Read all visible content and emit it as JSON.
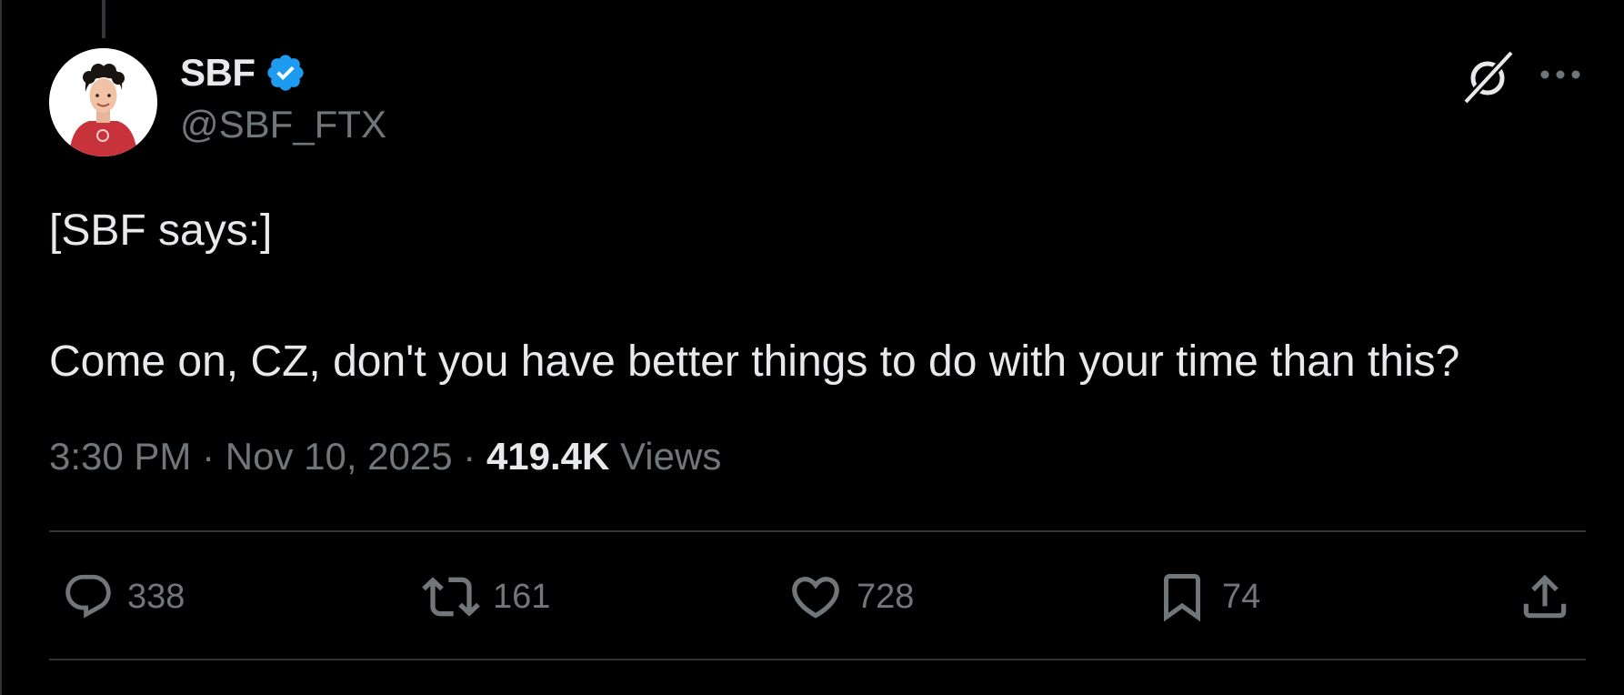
{
  "author": {
    "display_name": "SBF",
    "handle": "@SBF_FTX",
    "verified": true
  },
  "tweet": {
    "text": "[SBF says:]\n\nCome on, CZ, don't you have better things to do with your time than this?"
  },
  "meta": {
    "time": "3:30 PM",
    "date": "Nov 10, 2025",
    "separator": " · ",
    "views_count": "419.4K",
    "views_label": "Views"
  },
  "actions": {
    "replies": "338",
    "reposts": "161",
    "likes": "728",
    "bookmarks": "74"
  },
  "icons": {
    "verified": "verified-badge-icon",
    "grok": "grok-icon",
    "more": "more-dots-icon",
    "reply": "reply-bubble-icon",
    "repost": "repost-arrows-icon",
    "like": "heart-icon",
    "bookmark": "bookmark-icon",
    "share": "share-upload-icon"
  },
  "colors": {
    "background": "#000000",
    "primary_text": "#e7e9ea",
    "secondary_text": "#71767b",
    "verified_blue": "#1d9bf0",
    "divider": "#2f3336"
  }
}
